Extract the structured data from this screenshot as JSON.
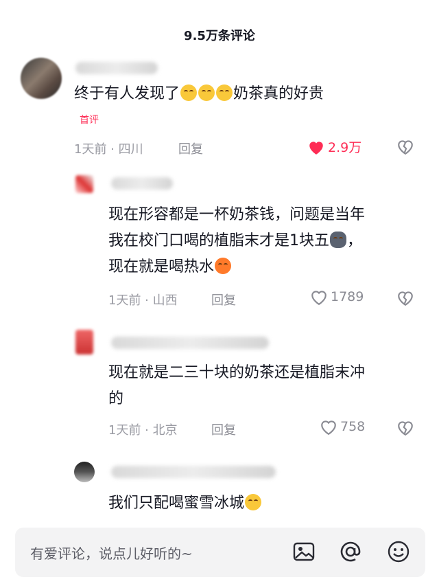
{
  "header": {
    "title": "9.5万条评论"
  },
  "comments": [
    {
      "text": "终于有人发现了",
      "text_after_emoji": "奶茶真的好贵",
      "emojis": [
        "laugh-cry-emoji",
        "laugh-cry-emoji",
        "laugh-cry-emoji"
      ],
      "badge": "首评",
      "meta": "1天前 · 四川",
      "reply_label": "回复",
      "likes": "2.9万",
      "liked": true
    },
    {
      "line1": "现在形容都是一杯奶茶钱，问题是当年",
      "line2": "我在校门口喝的植脂末才是1块五",
      "line3": "现在就是喝热水",
      "meta": "1天前 · 山西",
      "reply_label": "回复",
      "likes": "1789"
    },
    {
      "line1": "现在就是二三十块的奶茶还是植脂末冲",
      "line2": "的",
      "meta": "1天前 · 北京",
      "reply_label": "回复",
      "likes": "758"
    },
    {
      "line1": "我们只配喝蜜雪冰城"
    }
  ],
  "input": {
    "placeholder": "有爱评论，说点儿好听的~"
  },
  "icons": [
    "image-icon",
    "at-icon",
    "emoji-icon"
  ],
  "colors": {
    "accent": "#fe2c55",
    "muted": "#9a9ba3"
  }
}
